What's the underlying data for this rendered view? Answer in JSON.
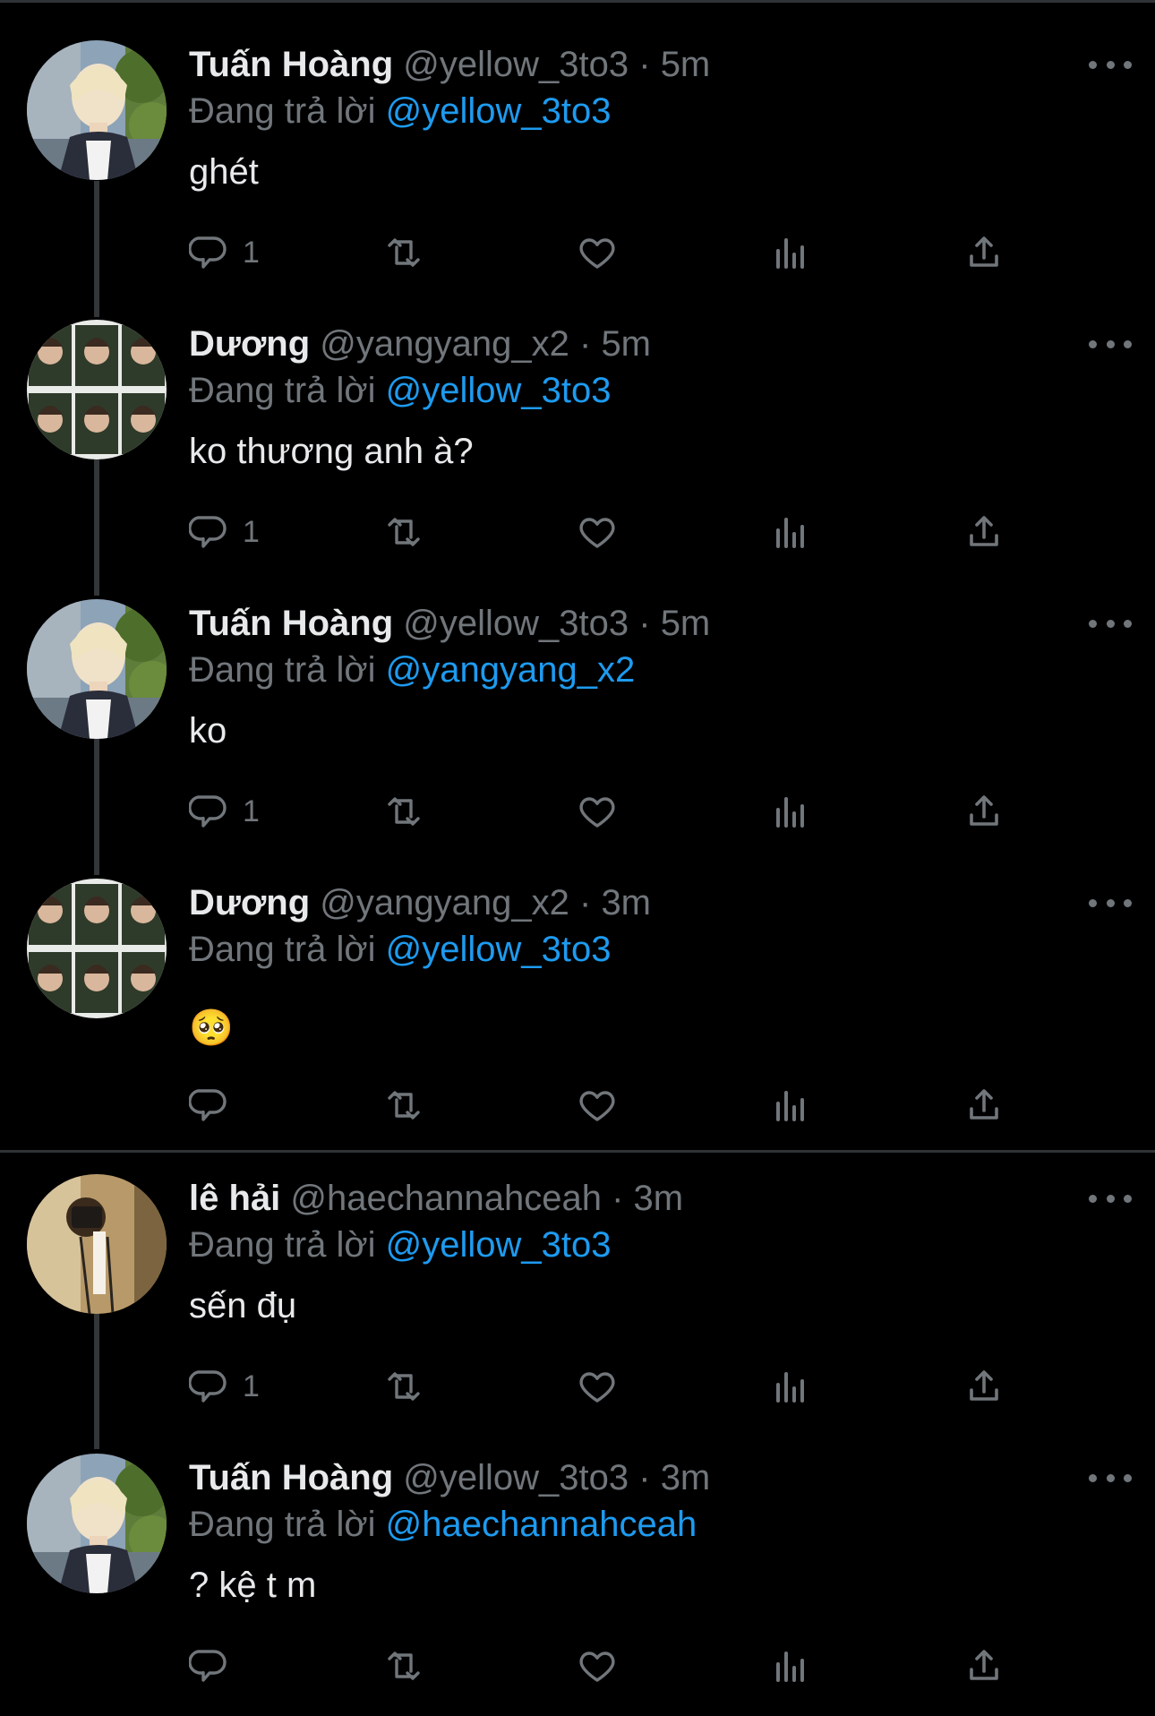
{
  "reply_prefix": "Đang trả lời",
  "tweets": [
    {
      "name": "Tuấn Hoàng",
      "handle": "@yellow_3to3",
      "time": "5m",
      "reply_to": "@yellow_3to3",
      "text": "ghét",
      "reply_count": "1",
      "avatar": "tuan-hoang-avatar"
    },
    {
      "name": "Dương",
      "handle": "@yangyang_x2",
      "time": "5m",
      "reply_to": "@yellow_3to3",
      "text": "ko thương anh à?",
      "reply_count": "1",
      "avatar": "duong-avatar"
    },
    {
      "name": "Tuấn Hoàng",
      "handle": "@yellow_3to3",
      "time": "5m",
      "reply_to": "@yangyang_x2",
      "text": "ko",
      "reply_count": "1",
      "avatar": "tuan-hoang-avatar"
    },
    {
      "name": "Dương",
      "handle": "@yangyang_x2",
      "time": "3m",
      "reply_to": "@yellow_3to3",
      "text": "🥺",
      "reply_count": "",
      "avatar": "duong-avatar"
    },
    {
      "name": "lê hải",
      "handle": "@haechannahceah",
      "time": "3m",
      "reply_to": "@yellow_3to3",
      "text": "sến đụ",
      "reply_count": "1",
      "avatar": "le-hai-avatar"
    },
    {
      "name": "Tuấn Hoàng",
      "handle": "@yellow_3to3",
      "time": "3m",
      "reply_to": "@haechannahceah",
      "text": "? kệ t m",
      "reply_count": "",
      "avatar": "tuan-hoang-avatar"
    }
  ],
  "colors": {
    "background": "#000000",
    "text": "#e7e9ea",
    "muted": "#71767b",
    "link": "#1d9bf0"
  },
  "icons": [
    "reply-icon",
    "retweet-icon",
    "like-icon",
    "views-icon",
    "share-icon",
    "more-icon"
  ]
}
